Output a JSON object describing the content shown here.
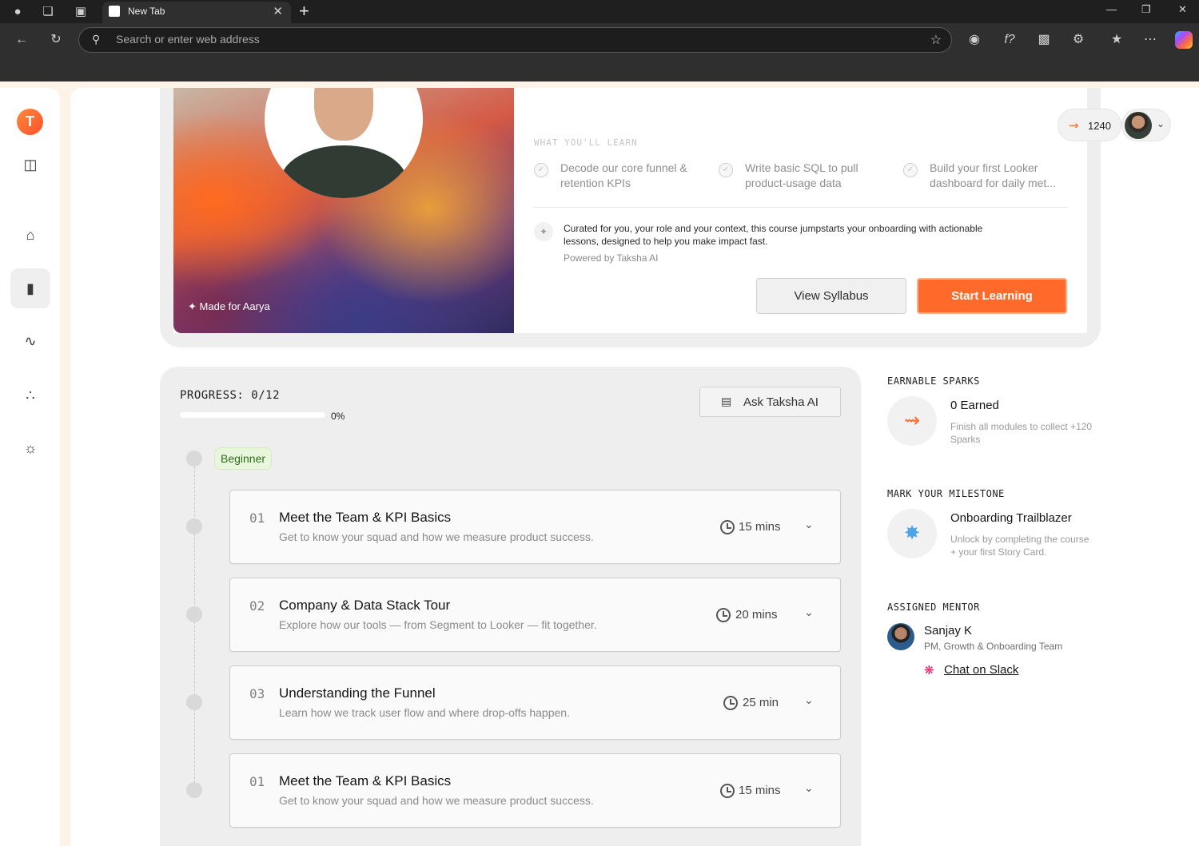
{
  "browser": {
    "tab_title": "New Tab",
    "address_placeholder": "Search or enter web address"
  },
  "header": {
    "sparks_count": "1240"
  },
  "hero": {
    "made_for": "Made for Aarya",
    "learn_label": "WHAT YOU'LL LEARN",
    "outcomes": [
      "Decode our core funnel & retention KPIs",
      "Write basic SQL to pull product-usage data",
      "Build your first Looker dashboard for daily met..."
    ],
    "curated_text": "Curated for you, your role and your context, this course jumpstarts your onboarding with actionable lessons, designed to help you make impact fast.",
    "powered_by": "Powered by Taksha AI",
    "view_syllabus": "View Syllabus",
    "start_learning": "Start Learning"
  },
  "progress": {
    "label": "PROGRESS: 0/12",
    "percent_text": "0%",
    "percent_value": 0,
    "ask_ai": "Ask Taksha AI",
    "level": "Beginner"
  },
  "modules": [
    {
      "num": "01",
      "title": "Meet the Team & KPI Basics",
      "desc": "Get to know your squad and how we measure product success.",
      "duration": "15 mins"
    },
    {
      "num": "02",
      "title": "Company & Data Stack Tour",
      "desc": "Explore how our tools — from Segment to Looker — fit together.",
      "duration": "20 mins"
    },
    {
      "num": "03",
      "title": "Understanding the Funnel",
      "desc": "Learn how we track user flow and where drop-offs happen.",
      "duration": "25 min"
    },
    {
      "num": "01",
      "title": "Meet the Team & KPI Basics",
      "desc": "Get to know your squad and how we measure product success.",
      "duration": "15 mins"
    }
  ],
  "sidebar": {
    "earnable_label": "EARNABLE SPARKS",
    "earned_title": "0 Earned",
    "earned_desc": "Finish all modules to collect +120 Sparks",
    "milestone_label": "MARK YOUR MILESTONE",
    "milestone_title": "Onboarding Trailblazer",
    "milestone_desc": "Unlock by completing the course + your first Story Card.",
    "mentor_label": "ASSIGNED MENTOR",
    "mentor_name": "Sanjay K",
    "mentor_role": "PM, Growth & Onboarding Team",
    "slack_link": "Chat on Slack"
  },
  "colors": {
    "accent": "#ff6a2b",
    "badge_bg": "#e8f7dc"
  },
  "icons": [
    "profile-icon",
    "workspaces-icon",
    "tab-actions-icon",
    "back-icon",
    "refresh-icon",
    "search-icon",
    "favorite-star-icon",
    "sidebar-toggle-icon",
    "home-icon",
    "book-icon",
    "path-icon",
    "community-icon",
    "brain-icon",
    "spark-icon",
    "message-icon",
    "clock-icon",
    "chevron-down-icon",
    "slack-icon"
  ]
}
